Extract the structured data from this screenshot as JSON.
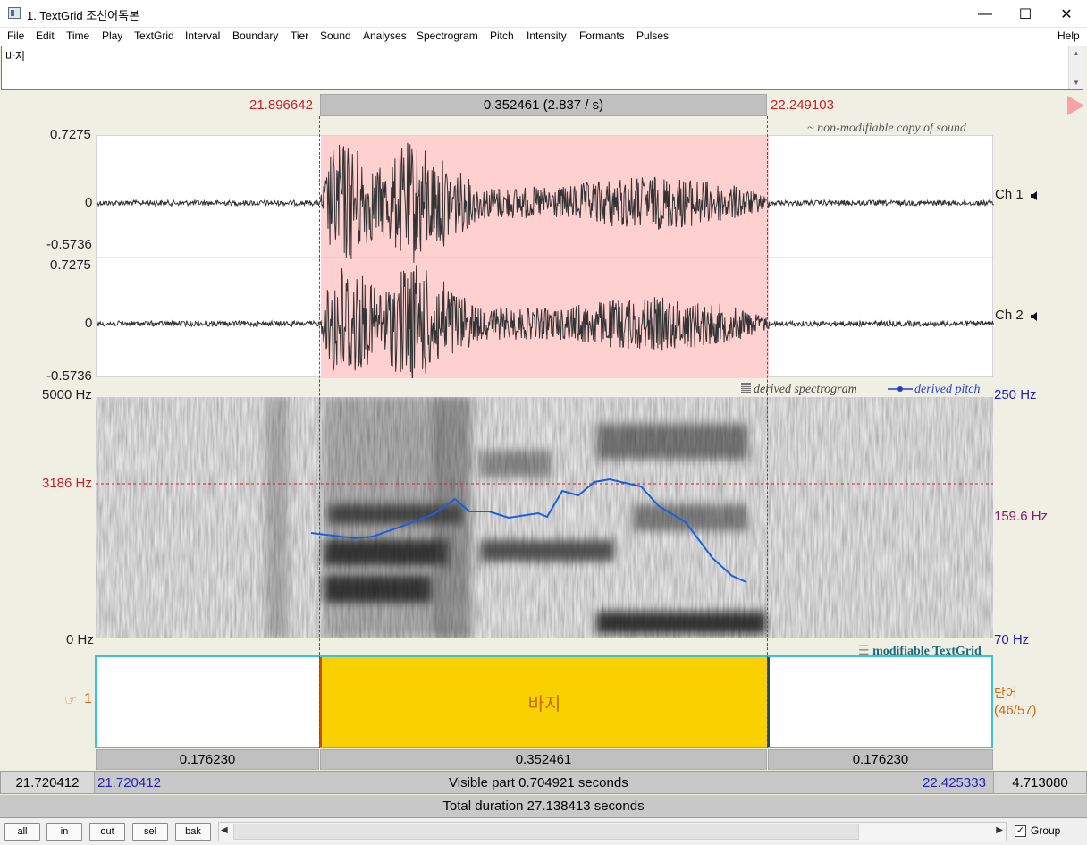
{
  "window": {
    "title": "1. TextGrid 조선어독본",
    "minimize": "—",
    "maximize": "☐",
    "close": "✕"
  },
  "menu": [
    "File",
    "Edit",
    "Time",
    "Play",
    "TextGrid",
    "Interval",
    "Boundary",
    "Tier",
    "Sound",
    "Analyses",
    "Spectrogram",
    "Pitch",
    "Intensity",
    "Formants",
    "Pulses"
  ],
  "help": "Help",
  "text_field": {
    "value": "바지"
  },
  "selection": {
    "start": "21.896642",
    "end": "22.249103",
    "duration_label": "0.352461 (2.837 / s)"
  },
  "sound": {
    "label": "~ non-modifiable copy of sound",
    "ch1": {
      "label": "Ch 1",
      "max": "0.7275",
      "zero": "0",
      "min": "-0.5736"
    },
    "ch2": {
      "label": "Ch 2",
      "max": "0.7275",
      "zero": "0",
      "min": "-0.5736"
    },
    "speaker_icon": "speaker-icon"
  },
  "spectrogram": {
    "label": "derived spectrogram",
    "pitch_label": "derived pitch",
    "top_freq": "5000 Hz",
    "cursor_freq": "3186 Hz",
    "bottom_freq": "0 Hz",
    "pitch_top": "250 Hz",
    "pitch_cursor": "159.6 Hz",
    "pitch_bottom": "70 Hz"
  },
  "textgrid": {
    "label": "modifiable TextGrid",
    "tier_number": "1",
    "tier_name": "단어",
    "tier_count": "(46/57)",
    "interval_text": "바지",
    "interval_color": "#f9d000"
  },
  "durations": {
    "left": "0.176230",
    "middle": "0.352461",
    "right": "0.176230"
  },
  "visible": {
    "left_outer": "21.720412",
    "left_inner": "21.720412",
    "label": "Visible part 0.704921 seconds",
    "right_inner": "22.425333",
    "right_outer": "4.713080"
  },
  "total": "Total duration 27.138413 seconds",
  "buttons": [
    "all",
    "in",
    "out",
    "sel",
    "bak"
  ],
  "group_label": "Group",
  "group_checked": true,
  "colors": {
    "selection": "#ffd0d0",
    "cursor": "#cc1f1f",
    "pitch": "#1a5fe0",
    "tier_border": "#3cc3d8"
  }
}
